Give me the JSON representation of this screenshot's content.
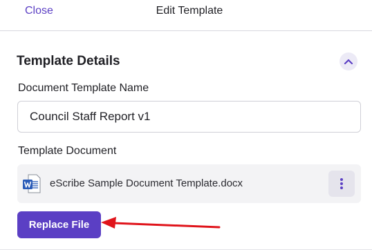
{
  "header": {
    "close_label": "Close",
    "title": "Edit Template"
  },
  "section": {
    "title": "Template Details",
    "collapse_icon": "chevron-up-icon"
  },
  "fields": {
    "name_label": "Document Template Name",
    "name_value": "Council Staff Report v1",
    "document_label": "Template Document"
  },
  "file": {
    "icon": "word-document-icon",
    "name": "eScribe Sample Document Template.docx",
    "menu_icon": "more-vertical-icon"
  },
  "actions": {
    "replace_label": "Replace File"
  },
  "colors": {
    "accent": "#5b3fc4",
    "annotation": "#e0141b",
    "word_blue": "#2b5cb8"
  }
}
